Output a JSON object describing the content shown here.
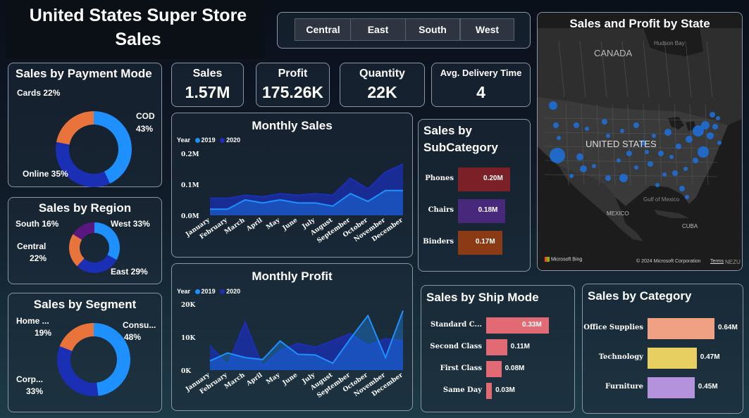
{
  "title": "United States Super Store Sales",
  "region_slicer": [
    "Central",
    "East",
    "South",
    "West"
  ],
  "colors": {
    "accent": "#1e90ff",
    "dark_blue": "#1b2fb5",
    "orange": "#e8743b",
    "purple": "#5b1780"
  },
  "kpis": [
    {
      "label": "Sales",
      "value": "1.57M"
    },
    {
      "label": "Profit",
      "value": "175.26K"
    },
    {
      "label": "Quantity",
      "value": "22K"
    },
    {
      "label": "Avg. Delivery Time",
      "value": "4"
    }
  ],
  "payment_mode": {
    "title": "Sales by Payment Mode",
    "labels": {
      "cards": "Cards 22%",
      "cod_name": "COD",
      "cod_pct": "43%",
      "online": "Online 35%"
    },
    "chart_data": {
      "type": "pie",
      "labels": [
        "COD",
        "Online",
        "Cards"
      ],
      "values": [
        43,
        35,
        22
      ],
      "colors": [
        "#1e90ff",
        "#1b2fb5",
        "#e8743b"
      ]
    }
  },
  "region": {
    "title": "Sales by Region",
    "labels": {
      "south": "South 16%",
      "west": "West 33%",
      "central_name": "Central",
      "central_pct": "22%",
      "east": "East 29%"
    },
    "chart_data": {
      "type": "pie",
      "labels": [
        "West",
        "East",
        "Central",
        "South"
      ],
      "values": [
        33,
        29,
        22,
        16
      ],
      "colors": [
        "#1e90ff",
        "#1b2fb5",
        "#e8743b",
        "#5b1780"
      ]
    }
  },
  "segment": {
    "title": "Sales by Segment",
    "labels": {
      "home_name": "Home ...",
      "home_pct": "19%",
      "consumer_name": "Consu...",
      "consumer_pct": "48%",
      "corp_name": "Corp...",
      "corp_pct": "33%"
    },
    "chart_data": {
      "type": "pie",
      "labels": [
        "Consumer",
        "Corporate",
        "Home Office"
      ],
      "values": [
        48,
        33,
        19
      ],
      "colors": [
        "#1e90ff",
        "#1b2fb5",
        "#e8743b"
      ]
    }
  },
  "legend": {
    "year_label": "Year",
    "series": [
      "2019",
      "2020"
    ]
  },
  "monthly_sales": {
    "title": "Monthly Sales",
    "yticks": [
      "0.2M",
      "0.1M",
      "0.0M"
    ],
    "chart_data": {
      "type": "area",
      "categories": [
        "January",
        "February",
        "March",
        "April",
        "May",
        "June",
        "July",
        "August",
        "September",
        "October",
        "November",
        "December"
      ],
      "series": [
        {
          "name": "2019",
          "values": [
            0.02,
            0.02,
            0.05,
            0.04,
            0.05,
            0.04,
            0.04,
            0.03,
            0.07,
            0.045,
            0.08,
            0.08
          ],
          "color": "#1e90ff"
        },
        {
          "name": "2020",
          "values": [
            0.055,
            0.055,
            0.065,
            0.06,
            0.07,
            0.065,
            0.07,
            0.065,
            0.12,
            0.085,
            0.14,
            0.165
          ],
          "color": "#1b2fb5"
        }
      ],
      "ylim": [
        0,
        0.2
      ]
    }
  },
  "monthly_profit": {
    "title": "Monthly Profit",
    "yticks": [
      "20K",
      "10K",
      "0K"
    ],
    "chart_data": {
      "type": "area",
      "categories": [
        "January",
        "February",
        "March",
        "April",
        "May",
        "June",
        "July",
        "August",
        "September",
        "October",
        "November",
        "December"
      ],
      "series": [
        {
          "name": "2019",
          "values": [
            2800,
            5200,
            3800,
            3200,
            8800,
            4800,
            4600,
            2100,
            9500,
            16500,
            3800,
            18000
          ],
          "color": "#1e90ff"
        },
        {
          "name": "2020",
          "values": [
            7500,
            1500,
            14500,
            1200,
            5900,
            8100,
            6900,
            8900,
            11000,
            7600,
            9500,
            8800
          ],
          "color": "#1b2fb5"
        }
      ],
      "ylim": [
        0,
        20000
      ]
    }
  },
  "subcategory": {
    "title_line1": "Sales by",
    "title_line2": "SubCategory",
    "chart_data": {
      "type": "bar",
      "categories": [
        "Phones",
        "Chairs",
        "Binders"
      ],
      "values": [
        0.2,
        0.18,
        0.17
      ],
      "labels": [
        "0.20M",
        "0.18M",
        "0.17M"
      ],
      "colors": [
        "#7a2026",
        "#47287a",
        "#8a3a14"
      ],
      "xlim": [
        0,
        0.2
      ]
    }
  },
  "ship_mode": {
    "title": "Sales by Ship Mode",
    "chart_data": {
      "type": "bar",
      "categories": [
        "Standard C...",
        "Second Class",
        "First Class",
        "Same Day"
      ],
      "values": [
        0.33,
        0.11,
        0.08,
        0.03
      ],
      "labels": [
        "0.33M",
        "0.11M",
        "0.08M",
        "0.03M"
      ],
      "color": "#e26a74",
      "xlim": [
        0,
        0.33
      ]
    }
  },
  "category": {
    "title": "Sales by Category",
    "chart_data": {
      "type": "bar",
      "categories": [
        "Office Supplies",
        "Technology",
        "Furniture"
      ],
      "values": [
        0.64,
        0.47,
        0.45
      ],
      "labels": [
        "0.64M",
        "0.47M",
        "0.45M"
      ],
      "colors": [
        "#f0a083",
        "#e8cf62",
        "#b593dc"
      ],
      "xlim": [
        0,
        0.64
      ]
    }
  },
  "map": {
    "title": "Sales and Profit by State",
    "labels": {
      "canada": "CANADA",
      "hudson": "Hudson Bay",
      "us": "UNITED STATES",
      "mexico": "MEXICO",
      "gulf": "Gulf of Mexico",
      "cuba": "CUBA",
      "nezu": "NEZU"
    },
    "attribution": "© 2024 Microsoft Corporation",
    "terms": "Terms",
    "bing": "Microsoft Bing"
  }
}
